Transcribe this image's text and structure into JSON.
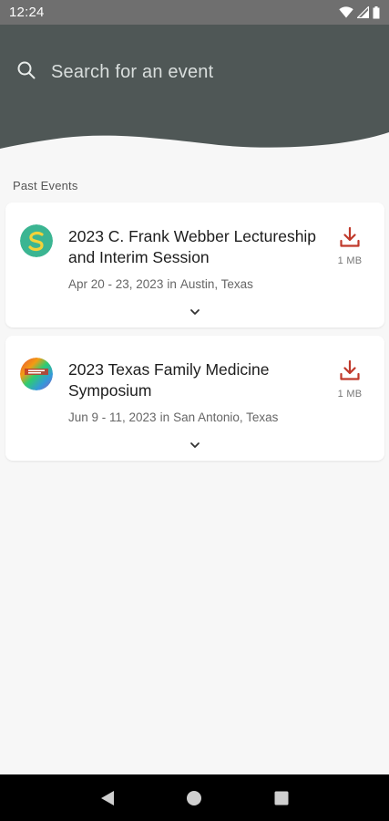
{
  "status_bar": {
    "time": "12:24",
    "icons": [
      "wifi-icon",
      "cell-signal-icon",
      "battery-icon"
    ]
  },
  "search": {
    "placeholder": "Search for an event",
    "icon": "search-icon"
  },
  "section": {
    "label": "Past Events"
  },
  "events": [
    {
      "title": "2023 C. Frank Webber Lectureship and Interim Session",
      "dates": "Apr 20 - 23, 2023",
      "in": "in",
      "location": "Austin, Texas",
      "download_size": "1 MB",
      "logo": "green-circle-logo"
    },
    {
      "title": "2023 Texas Family Medicine Symposium",
      "dates": "Jun 9 - 11, 2023",
      "in": "in",
      "location": "San Antonio, Texas",
      "download_size": "1 MB",
      "logo": "rainbow-circle-logo"
    }
  ],
  "colors": {
    "header": "#4f5756",
    "accent": "#c0392b",
    "card_bg": "#ffffff",
    "page_bg": "#f7f7f7"
  },
  "nav": {
    "icons": [
      "back-icon",
      "home-icon",
      "recents-icon"
    ]
  }
}
